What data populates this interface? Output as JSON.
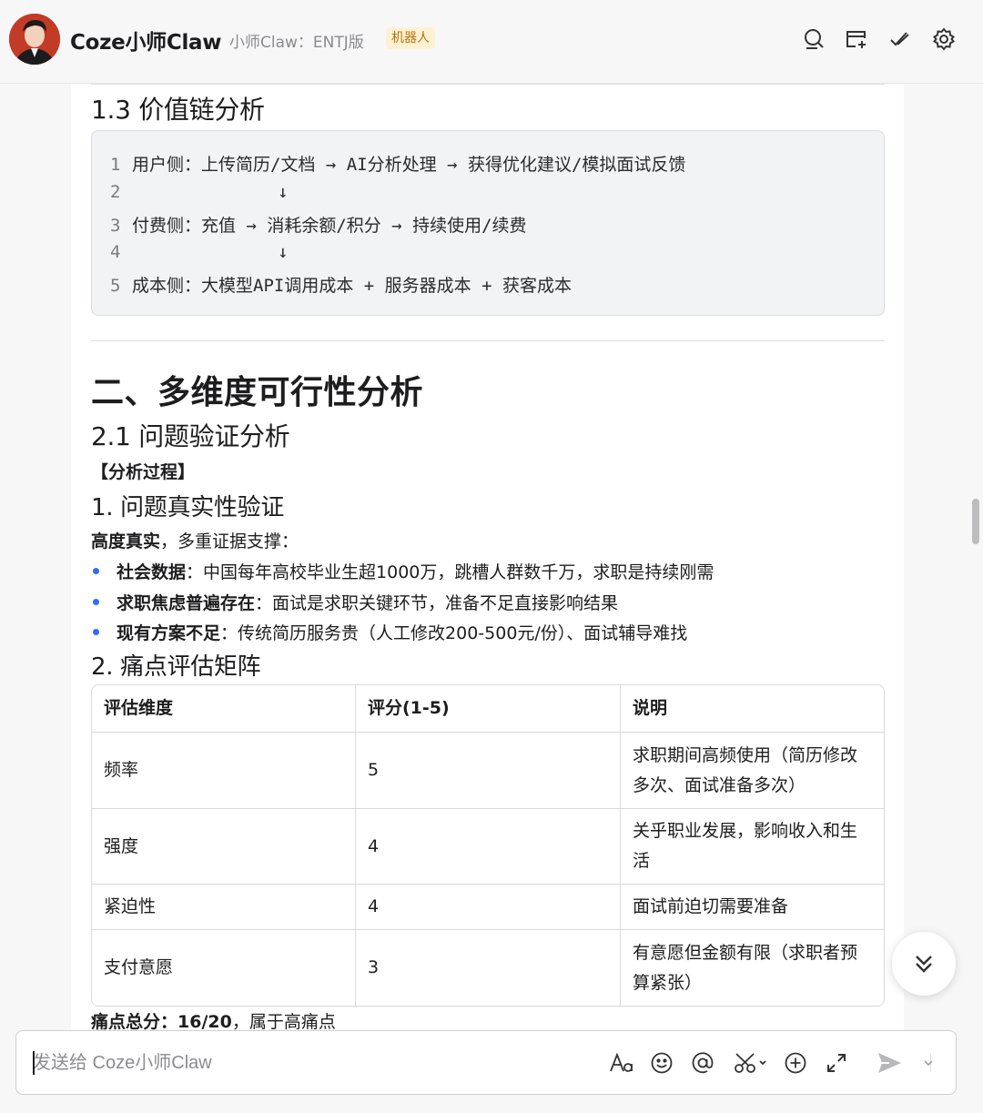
{
  "header": {
    "title": "Coze小师Claw",
    "subtitle": "小师Claw：ENTJ版",
    "badge": "机器人",
    "icons": [
      "search-icon",
      "new-chat-icon",
      "edit-check-icon",
      "settings-icon"
    ]
  },
  "content": {
    "section_13_title": "1.3 价值链分析",
    "code_lines": [
      {
        "num": "1",
        "text": "用户侧：上传简历/文档 → AI分析处理 → 获得优化建议/模拟面试反馈"
      },
      {
        "num": "2",
        "text": "              ↓"
      },
      {
        "num": "3",
        "text": "付费侧：充值 → 消耗余额/积分 → 持续使用/续费"
      },
      {
        "num": "4",
        "text": "              ↓"
      },
      {
        "num": "5",
        "text": "成本侧：大模型API调用成本 + 服务器成本 + 获客成本"
      }
    ],
    "section_2_title": "二、多维度可行性分析",
    "section_21_title": "2.1 问题验证分析",
    "analysis_label": "【分析过程】",
    "sub1_title": "1. 问题真实性验证",
    "verdict_bold": "高度真实",
    "verdict_rest": "，多重证据支撑：",
    "bullets": [
      {
        "bold": "社会数据",
        "text": "：中国每年高校毕业生超1000万，跳槽人群数千万，求职是持续刚需"
      },
      {
        "bold": "求职焦虑普遍存在",
        "text": "：面试是求职关键环节，准备不足直接影响结果"
      },
      {
        "bold": "现有方案不足",
        "text": "：传统简历服务贵（人工修改200-500元/份）、面试辅导难找"
      }
    ],
    "sub2_title": "2. 痛点评估矩阵",
    "table": {
      "headers": [
        "评估维度",
        "评分(1-5)",
        "说明"
      ],
      "rows": [
        [
          "频率",
          "5",
          "求职期间高频使用（简历修改多次、面试准备多次）"
        ],
        [
          "强度",
          "4",
          "关乎职业发展，影响收入和生活"
        ],
        [
          "紧迫性",
          "4",
          "面试前迫切需要准备"
        ],
        [
          "支付意愿",
          "3",
          "有意愿但金额有限（求职者预算紧张）"
        ]
      ]
    },
    "summary_bold": "痛点总分：16/20",
    "summary_rest": "，属于高痛点"
  },
  "input": {
    "placeholder": "发送给 Coze小师Claw",
    "value": "",
    "toolbar_icons": [
      "font-format-icon",
      "emoji-icon",
      "mention-icon",
      "scissors-icon",
      "add-icon",
      "expand-icon",
      "send-icon",
      "dropdown-icon"
    ]
  },
  "colors": {
    "bullet": "#2f6bff",
    "badge_bg": "#fdf1d3",
    "badge_text": "#b1740f",
    "code_bg": "#f2f3f5"
  }
}
